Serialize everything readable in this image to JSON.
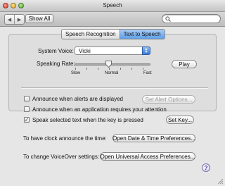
{
  "window": {
    "title": "Speech"
  },
  "toolbar": {
    "back_glyph": "◀",
    "forward_glyph": "▶",
    "show_all_label": "Show All",
    "search": {
      "value": "",
      "placeholder": ""
    }
  },
  "tabs": [
    {
      "label": "Speech Recognition",
      "selected": false
    },
    {
      "label": "Text to Speech",
      "selected": true
    }
  ],
  "voice": {
    "label": "System Voice:",
    "selected": "Vicki"
  },
  "rate": {
    "label": "Speaking Rate:",
    "slow_label": "Slow",
    "normal_label": "Normal",
    "fast_label": "Fast",
    "value": 0.45,
    "play_label": "Play"
  },
  "options": [
    {
      "label": "Announce when alerts are displayed",
      "checked": false
    },
    {
      "label": "Announce when an application requires your attention",
      "checked": false
    },
    {
      "label": "Speak selected text when the key is pressed",
      "checked": true
    }
  ],
  "set_alert_button": {
    "label": "Set Alert Options...",
    "enabled": false
  },
  "set_key_button": {
    "label": "Set Key...",
    "enabled": true
  },
  "clock": {
    "label": "To have clock announce the time:",
    "button": "Open Date & Time Preferences..."
  },
  "voiceover": {
    "label": "To change VoiceOver settings:",
    "button": "Open Universal Access Preferences..."
  },
  "help": {
    "glyph": "?"
  },
  "colors": {
    "accent": "#5e9ee8",
    "background": "#e6e6e6"
  }
}
